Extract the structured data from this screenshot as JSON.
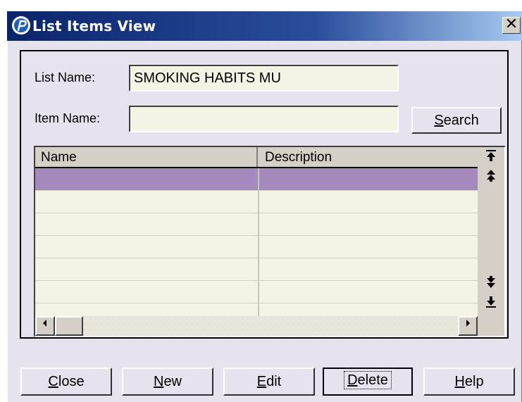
{
  "window": {
    "title": "List Items View",
    "close_glyph": "✕",
    "colors": {
      "titlebar": "#0a246a",
      "background": "#e6e3ef",
      "field": "#f3f4e3",
      "selection": "#a589bd"
    }
  },
  "form": {
    "list_name_label": "List Name:",
    "list_name_value": "SMOKING HABITS MU",
    "item_name_label": "Item Name:",
    "item_name_value": "",
    "search_button": {
      "accel": "S",
      "rest": "earch"
    }
  },
  "grid": {
    "columns": [
      "Name",
      "Description"
    ],
    "rows": [
      {
        "name": "",
        "description": "",
        "selected": true
      },
      {
        "name": "",
        "description": "",
        "selected": false
      },
      {
        "name": "",
        "description": "",
        "selected": false
      },
      {
        "name": "",
        "description": "",
        "selected": false
      },
      {
        "name": "",
        "description": "",
        "selected": false
      },
      {
        "name": "",
        "description": "",
        "selected": false
      }
    ],
    "scroll_icons": {
      "top": "arrow-top-icon",
      "page_up": "double-arrow-up-icon",
      "page_down": "double-arrow-down-icon",
      "bottom": "arrow-bottom-icon",
      "left": "scroll-left-icon",
      "right": "scroll-right-icon"
    }
  },
  "buttons": {
    "close": {
      "accel": "C",
      "rest": "lose"
    },
    "new": {
      "accel": "N",
      "rest": "ew"
    },
    "edit": {
      "accel": "E",
      "rest": "dit"
    },
    "delete": {
      "accel": "D",
      "rest": "elete"
    },
    "help": {
      "accel": "H",
      "rest": "elp"
    }
  }
}
